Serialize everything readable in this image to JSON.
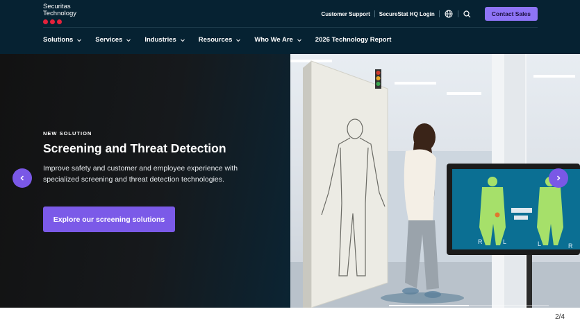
{
  "header": {
    "logo_line1": "Securitas",
    "logo_line2": "Technology",
    "util_links": [
      "Customer Support",
      "SecureStat HQ Login"
    ],
    "contact_label": "Contact Sales"
  },
  "nav": {
    "items": [
      {
        "label": "Solutions",
        "has_dropdown": true
      },
      {
        "label": "Services",
        "has_dropdown": true
      },
      {
        "label": "Industries",
        "has_dropdown": true
      },
      {
        "label": "Resources",
        "has_dropdown": true
      },
      {
        "label": "Who We Are",
        "has_dropdown": true
      },
      {
        "label": "2026 Technology Report",
        "has_dropdown": false
      }
    ]
  },
  "hero": {
    "eyebrow": "NEW SOLUTION",
    "title": "Screening and Threat Detection",
    "description": "Improve safety and customer and employee experience with specialized screening and threat detection technologies.",
    "cta_label": "Explore our screening solutions",
    "monitor_labels": [
      "R",
      "L",
      "L",
      "R"
    ],
    "slide_progress": 0.5
  },
  "carousel": {
    "counter": "2/4"
  },
  "colors": {
    "header_bg": "#062232",
    "accent": "#7b5ae8",
    "contact_btn": "#8e74f6",
    "logo_dots": "#e4223c"
  },
  "icons": [
    "globe-icon",
    "search-icon",
    "chevron-down-icon",
    "chevron-left-icon",
    "chevron-right-icon"
  ]
}
